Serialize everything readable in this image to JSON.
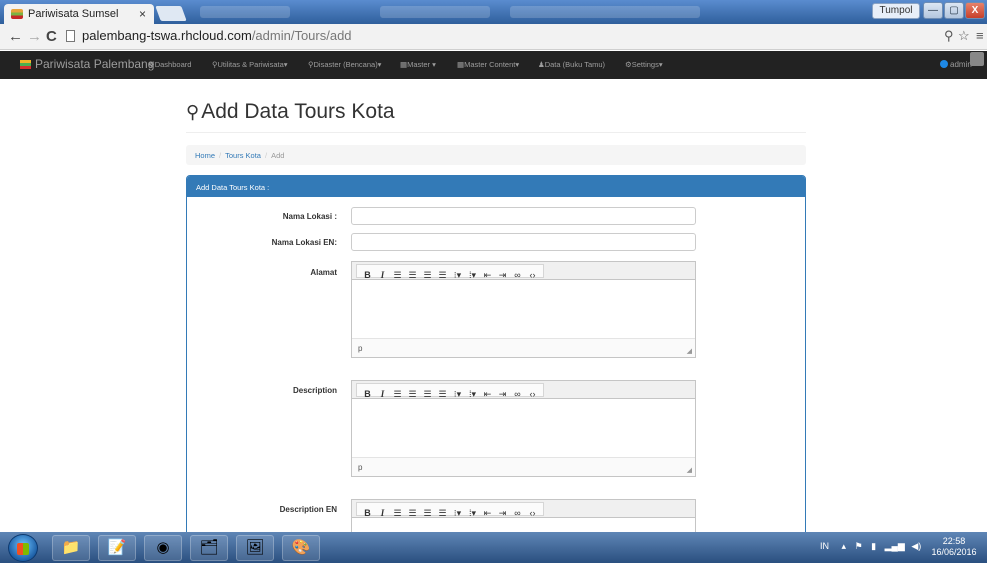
{
  "browser": {
    "tab_title": "Pariwisata Sumsel",
    "tab_close": "×",
    "user_chip": "Tumpol",
    "url_host": "palembang-tswa.rhcloud.com",
    "url_path": "/admin/Tours/add",
    "window_buttons": {
      "minimize": "—",
      "maximize": "▢",
      "close": "X"
    }
  },
  "navbar": {
    "brand": "Pariwisata Palembang",
    "items": [
      {
        "label": "❖Dashboard"
      },
      {
        "label": "⚲Utilitas & Pariwisata▾"
      },
      {
        "label": "⚲Disaster (Bencana)▾"
      },
      {
        "label": "▦Master ▾"
      },
      {
        "label": "▦Master Content▾"
      },
      {
        "label": "♟Data (Buku Tamu)"
      },
      {
        "label": "⚙Settings▾"
      }
    ],
    "user": "admin"
  },
  "page": {
    "title": "Add Data Tours Kota",
    "breadcrumb": {
      "home": "Home",
      "section": "Tours Kota",
      "current": "Add",
      "separator": "/"
    },
    "panel_title": "Add Data Tours Kota :",
    "fields": {
      "nama_lokasi": {
        "label": "Nama Lokasi :",
        "value": ""
      },
      "nama_lokasi_en": {
        "label": "Nama Lokasi EN:",
        "value": ""
      },
      "alamat": {
        "label": "Alamat",
        "status": "p"
      },
      "description": {
        "label": "Description",
        "status": "p"
      },
      "description_en": {
        "label": "Description EN"
      }
    }
  },
  "taskbar": {
    "tray_lang": "IN",
    "time": "22:58",
    "date": "16/06/2016"
  },
  "colors": {
    "navbar_bg": "#222222",
    "panel_primary": "#337ab7",
    "link": "#337ab7"
  }
}
